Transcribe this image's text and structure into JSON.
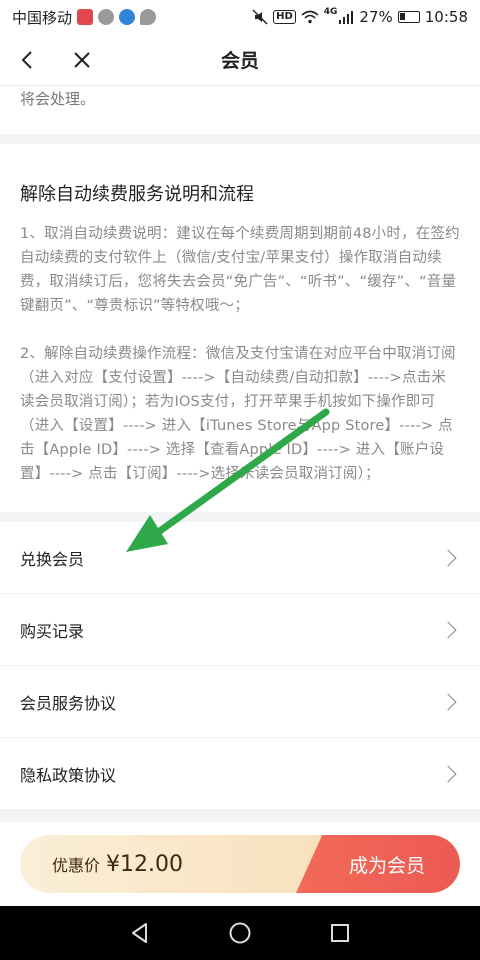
{
  "status_bar": {
    "carrier": "中国移动",
    "hd": "HD",
    "network": "4G",
    "battery": "27%",
    "time": "10:58"
  },
  "nav": {
    "title": "会员"
  },
  "content": {
    "top_fragment": "将会处理。",
    "info_title": "解除自动续费服务说明和流程",
    "para1": "1、取消自动续费说明：建议在每个续费周期到期前48小时，在签约自动续费的支付软件上（微信/支付宝/苹果支付）操作取消自动续费，取消续订后，您将失去会员“免广告”、“听书”、“缓存”、“音量键翻页”、“尊贵标识”等特权哦～；",
    "para2": "2、解除自动续费操作流程：微信及支付宝请在对应平台中取消订阅（进入对应【支付设置】---->【自动续费/自动扣款】---->点击米读会员取消订阅）；若为IOS支付，打开苹果手机按如下操作即可（进入【设置】----> 进入【iTunes Store与App Store】----> 点击【Apple ID】----> 选择【查看Apple ID】----> 进入【账户设置】----> 点击【订阅】---->选择米读会员取消订阅）；"
  },
  "menu": {
    "items": [
      {
        "label": "兑换会员"
      },
      {
        "label": "购买记录"
      },
      {
        "label": "会员服务协议"
      },
      {
        "label": "隐私政策协议"
      }
    ]
  },
  "buy_bar": {
    "price_label": "优惠价",
    "price_value": "¥12.00",
    "join_label": "成为会员"
  },
  "colors": {
    "accent_red": "#ec5a53",
    "gold_light": "#fbeed7",
    "annotation_green": "#2fa84a"
  }
}
